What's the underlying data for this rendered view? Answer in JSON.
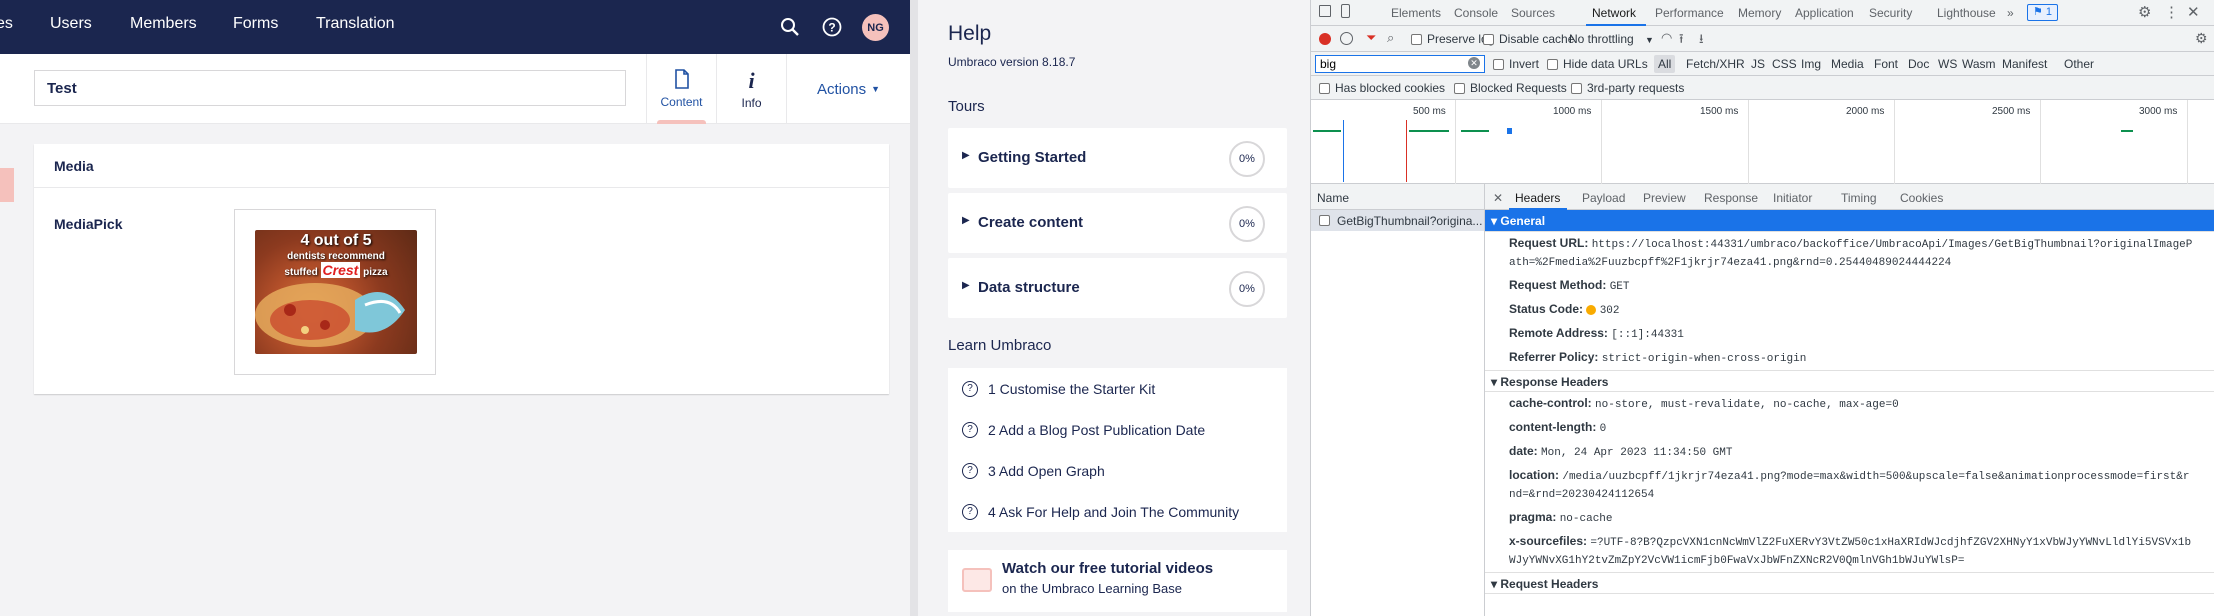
{
  "umbraco": {
    "nav": [
      "es",
      "Users",
      "Members",
      "Forms",
      "Translation"
    ],
    "avatar": "NG",
    "node_name": "Test",
    "tabs": {
      "content": "Content",
      "info": "Info"
    },
    "actions_label": "Actions",
    "group_title": "Media",
    "property_label": "MediaPick",
    "image_text": {
      "line1": "4 out of 5",
      "line2": "dentists recommend",
      "line3": "stuffed",
      "brand": "Crest",
      "line4": "pizza"
    }
  },
  "help": {
    "title": "Help",
    "version": "Umbraco version 8.18.7",
    "tours_label": "Tours",
    "tours": [
      {
        "label": "Getting Started",
        "pct": "0%"
      },
      {
        "label": "Create content",
        "pct": "0%"
      },
      {
        "label": "Data structure",
        "pct": "0%"
      }
    ],
    "learn_label": "Learn Umbraco",
    "learn_items": [
      "1 Customise the Starter Kit",
      "2 Add a Blog Post Publication Date",
      "3 Add Open Graph",
      "4 Ask For Help and Join The Community"
    ],
    "video_title": "Watch our free tutorial videos",
    "video_sub": "on the Umbraco Learning Base"
  },
  "devtools": {
    "tabs": [
      "Elements",
      "Console",
      "Sources",
      "Network",
      "Performance",
      "Memory",
      "Application",
      "Security",
      "Lighthouse"
    ],
    "active_tab": "Network",
    "issues_count": "1",
    "toolbar": {
      "preserve_log": "Preserve log",
      "disable_cache": "Disable cache",
      "throttling": "No throttling"
    },
    "filter_value": "big",
    "invert": "Invert",
    "hide_data_urls": "Hide data URLs",
    "filter_types": [
      "All",
      "Fetch/XHR",
      "JS",
      "CSS",
      "Img",
      "Media",
      "Font",
      "Doc",
      "WS",
      "Wasm",
      "Manifest",
      "Other"
    ],
    "has_blocked_cookies": "Has blocked cookies",
    "blocked_requests": "Blocked Requests",
    "third_party": "3rd-party requests",
    "timeline_ticks": [
      "500 ms",
      "1000 ms",
      "1500 ms",
      "2000 ms",
      "2500 ms",
      "3000 ms"
    ],
    "names_header": "Name",
    "request_name": "GetBigThumbnail?origina...",
    "detail_tabs": [
      "Headers",
      "Payload",
      "Preview",
      "Response",
      "Initiator",
      "Timing",
      "Cookies"
    ],
    "general": {
      "title": "General",
      "request_url_k": "Request URL:",
      "request_url_v1": "https://localhost:44331/umbraco/backoffice/UmbracoApi/Images/GetBigThumbnail?originalImageP",
      "request_url_v2": "ath=%2Fmedia%2Fuuzbcpff%2F1jkrjr74eza41.png&rnd=0.25440489024444224",
      "method_k": "Request Method:",
      "method_v": "GET",
      "status_k": "Status Code:",
      "status_v": "302",
      "remote_k": "Remote Address:",
      "remote_v": "[::1]:44331",
      "referrer_k": "Referrer Policy:",
      "referrer_v": "strict-origin-when-cross-origin"
    },
    "response_headers": {
      "title": "Response Headers",
      "cache_k": "cache-control:",
      "cache_v": "no-store, must-revalidate, no-cache, max-age=0",
      "len_k": "content-length:",
      "len_v": "0",
      "date_k": "date:",
      "date_v": "Mon, 24 Apr 2023 11:34:50 GMT",
      "loc_k": "location:",
      "loc_v1": "/media/uuzbcpff/1jkrjr74eza41.png?mode=max&width=500&upscale=false&animationprocessmode=first&r",
      "loc_v2": "nd=&rnd=20230424112654",
      "pragma_k": "pragma:",
      "pragma_v": "no-cache",
      "xsrc_k": "x-sourcefiles:",
      "xsrc_v1": "=?UTF-8?B?QzpcVXN1cnNcWmVlZ2FuXERvY3VtZW50c1xHaXRIdWJcdjhfZGV2XHNyY1xVbWJyYWNvLldlYi5VSVx1b",
      "xsrc_v2": "WJyYWNvXG1hY2tvZmZpY2VcVW1icmFjb0FwaVxJbWFnZXNcR2V0QmlnVGh1bWJuYWlsP="
    },
    "request_headers": {
      "title": "Request Headers"
    }
  }
}
